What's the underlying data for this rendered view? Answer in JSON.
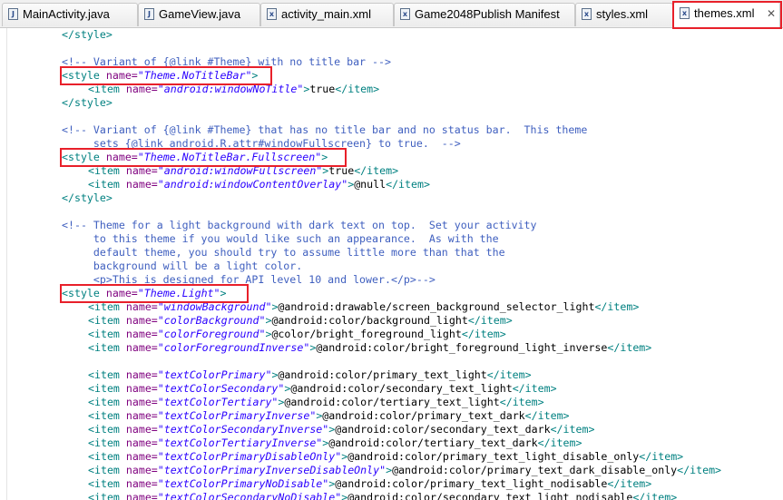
{
  "tabs": [
    {
      "label": "MainActivity.java",
      "icon": "J",
      "active": false
    },
    {
      "label": "GameView.java",
      "icon": "J",
      "active": false
    },
    {
      "label": "activity_main.xml",
      "icon": "x",
      "active": false
    },
    {
      "label": "Game2048Publish Manifest",
      "icon": "x",
      "active": false
    },
    {
      "label": "styles.xml",
      "icon": "x",
      "active": false
    },
    {
      "label": "themes.xml",
      "icon": "x",
      "active": true
    }
  ],
  "code": {
    "l0": "</style>",
    "l2": "<!-- Variant of {@link #Theme} with no title bar -->",
    "l3_open": "<style ",
    "l3_attr": "name=",
    "l3_val": "\"Theme.NoTitleBar\"",
    "l3_close": ">",
    "l4_open": "<item ",
    "l4_attr": "name=",
    "l4_val": "\"android:windowNoTitle\"",
    "l4_mid": ">",
    "l4_text": "true",
    "l4_end": "</item>",
    "l5": "</style>",
    "l7": "<!-- Variant of {@link #Theme} that has no title bar and no status bar.  This theme",
    "l8": "     sets {@link android.R.attr#windowFullscreen} to true.  -->",
    "l9_open": "<style ",
    "l9_attr": "name=",
    "l9_val": "\"Theme.NoTitleBar.Fullscreen\"",
    "l9_close": ">",
    "l10_open": "<item ",
    "l10_attr": "name=",
    "l10_val": "\"android:windowFullscreen\"",
    "l10_mid": ">",
    "l10_text": "true",
    "l10_end": "</item>",
    "l11_open": "<item ",
    "l11_attr": "name=",
    "l11_val": "\"android:windowContentOverlay\"",
    "l11_mid": ">",
    "l11_text": "@null",
    "l11_end": "</item>",
    "l12": "</style>",
    "l14": "<!-- Theme for a light background with dark text on top.  Set your activity",
    "l15": "     to this theme if you would like such an appearance.  As with the",
    "l16": "     default theme, you should try to assume little more than that the",
    "l17": "     background will be a light color.",
    "l18": "     <p>This is designed for API level 10 and lower.</p>-->",
    "l19_open": "<style ",
    "l19_attr": "name=",
    "l19_val": "\"Theme.Light\"",
    "l19_close": ">",
    "items": [
      {
        "name": "\"windowBackground\"",
        "value": "@android:drawable/screen_background_selector_light"
      },
      {
        "name": "\"colorBackground\"",
        "value": "@android:color/background_light"
      },
      {
        "name": "\"colorForeground\"",
        "value": "@color/bright_foreground_light"
      },
      {
        "name": "\"colorForegroundInverse\"",
        "value": "@android:color/bright_foreground_light_inverse"
      },
      null,
      {
        "name": "\"textColorPrimary\"",
        "value": "@android:color/primary_text_light"
      },
      {
        "name": "\"textColorSecondary\"",
        "value": "@android:color/secondary_text_light"
      },
      {
        "name": "\"textColorTertiary\"",
        "value": "@android:color/tertiary_text_light"
      },
      {
        "name": "\"textColorPrimaryInverse\"",
        "value": "@android:color/primary_text_dark"
      },
      {
        "name": "\"textColorSecondaryInverse\"",
        "value": "@android:color/secondary_text_dark"
      },
      {
        "name": "\"textColorTertiaryInverse\"",
        "value": "@android:color/tertiary_text_dark"
      },
      {
        "name": "\"textColorPrimaryDisableOnly\"",
        "value": "@android:color/primary_text_light_disable_only"
      },
      {
        "name": "\"textColorPrimaryInverseDisableOnly\"",
        "value": "@android:color/primary_text_dark_disable_only"
      },
      {
        "name": "\"textColorPrimaryNoDisable\"",
        "value": "@android:color/primary_text_light_nodisable"
      },
      {
        "name": "\"textColorSecondaryNoDisable\"",
        "value": "@android:color/secondary_text_light_nodisable"
      }
    ],
    "item_open": "<item ",
    "item_attr": "name=",
    "item_mid": ">",
    "item_end": "</item>"
  },
  "colors": {
    "tag": "#008080",
    "attribute": "#7f007f",
    "value": "#2a00ff",
    "comment": "#3f5fbf",
    "highlight": "#e8202a"
  }
}
